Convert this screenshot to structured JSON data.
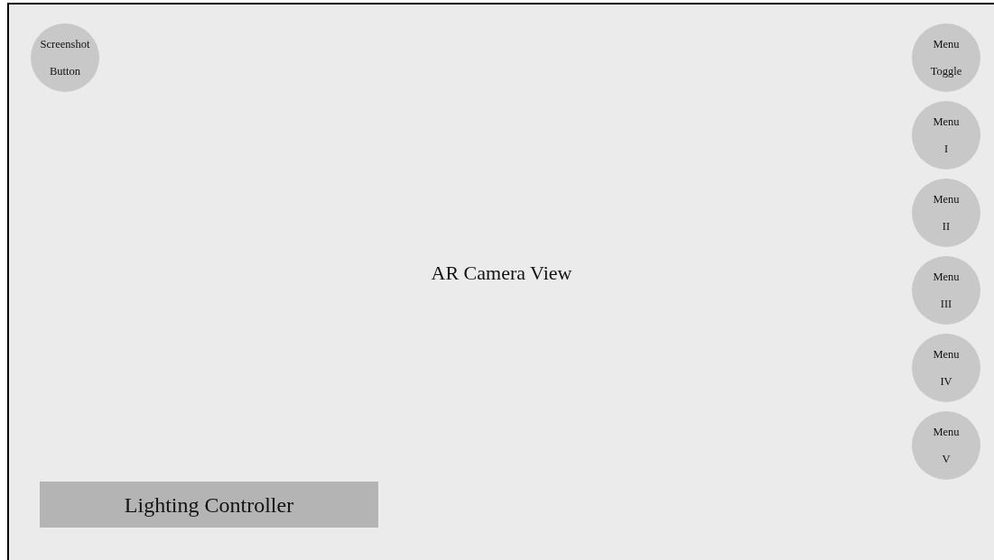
{
  "screenshot_button": {
    "lines": [
      "Screenshot",
      "Button"
    ]
  },
  "camera_view": {
    "label": "AR Camera View"
  },
  "menu_buttons": [
    {
      "lines": [
        "Menu",
        "Toggle"
      ]
    },
    {
      "lines": [
        "Menu",
        "I"
      ]
    },
    {
      "lines": [
        "Menu",
        "II"
      ]
    },
    {
      "lines": [
        "Menu",
        "III"
      ]
    },
    {
      "lines": [
        "Menu",
        "IV"
      ]
    },
    {
      "lines": [
        "Menu",
        "V"
      ]
    }
  ],
  "lighting_controller": {
    "label": "Lighting Controller"
  }
}
